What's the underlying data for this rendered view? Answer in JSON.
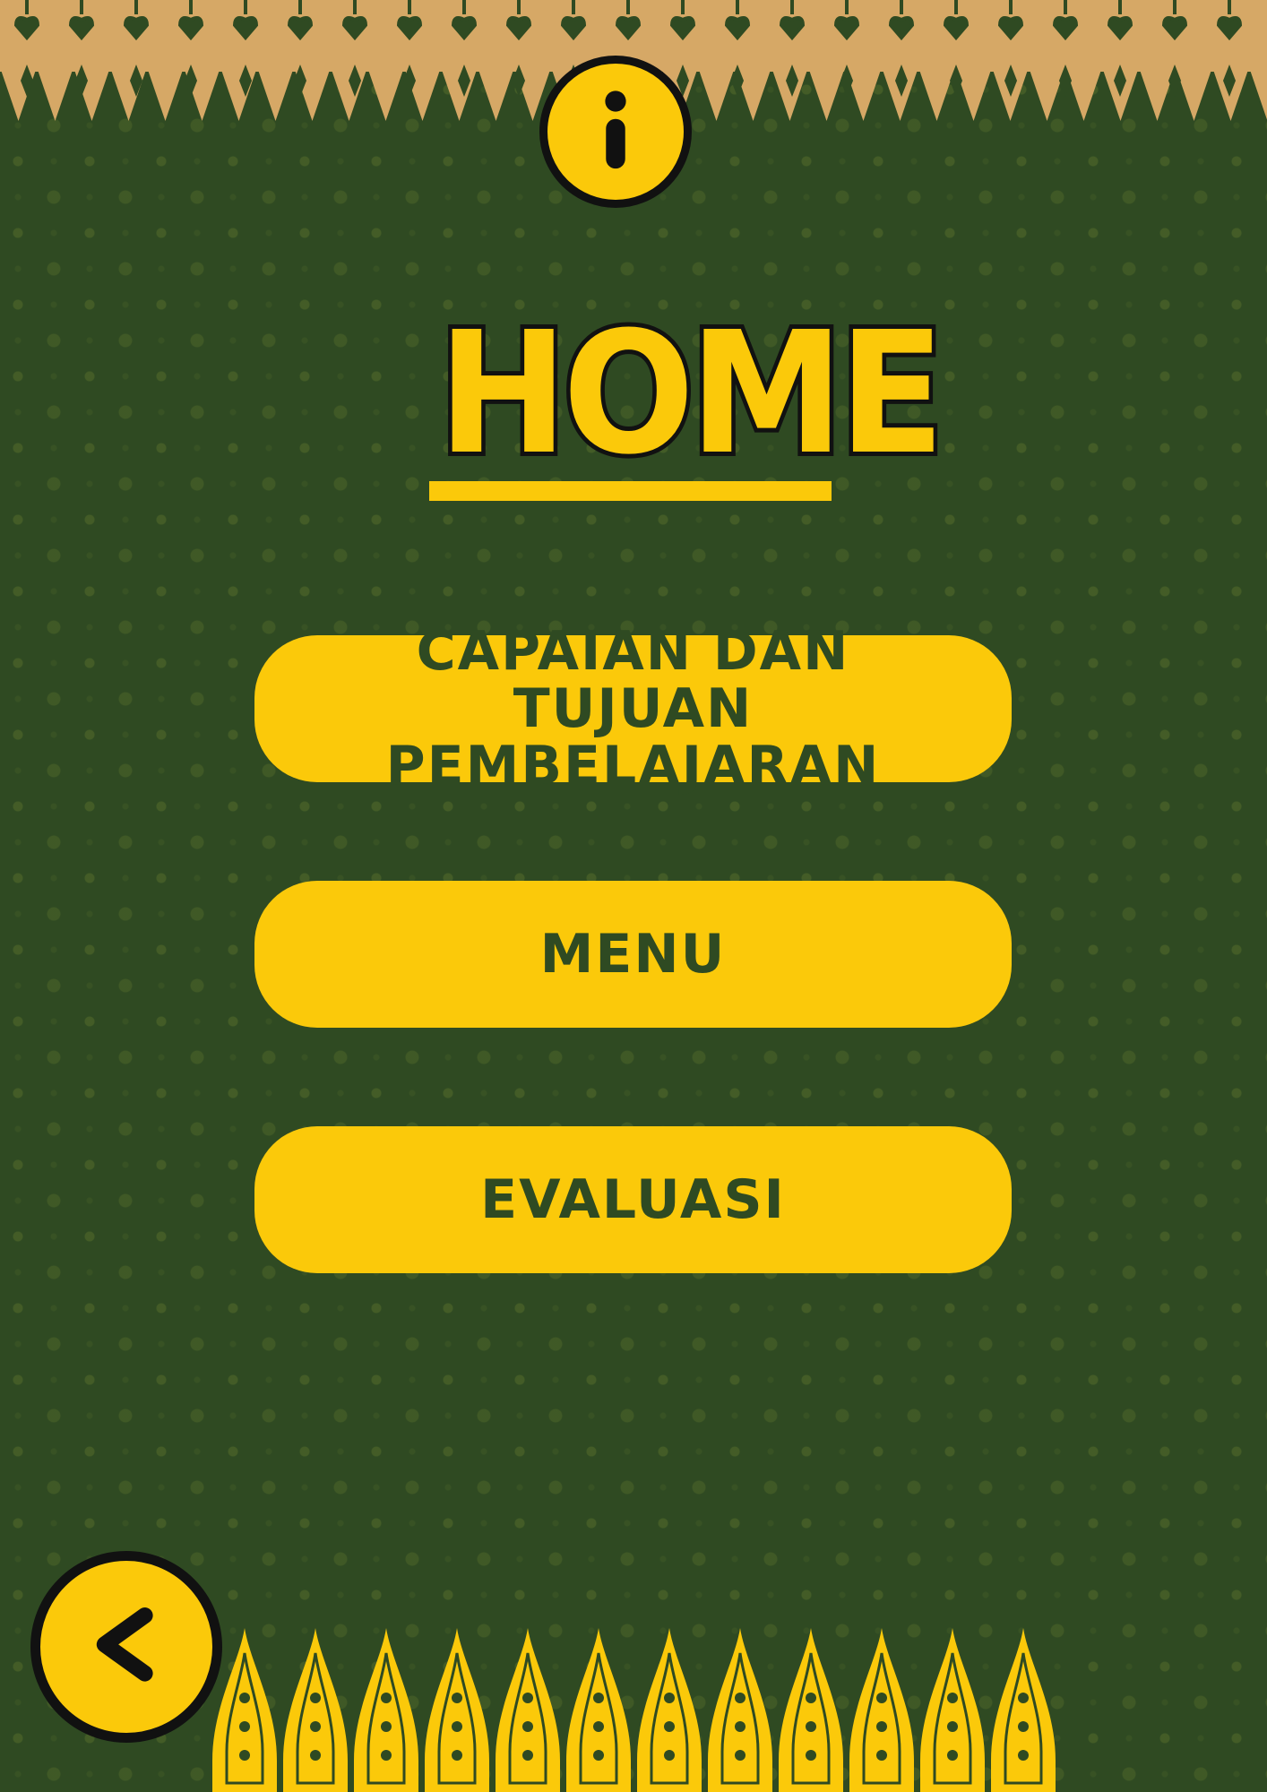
{
  "page": {
    "title": "HOME"
  },
  "header": {
    "info_icon": "info-icon"
  },
  "menu": {
    "buttons": [
      {
        "label": "CAPAIAN DAN TUJUAN\nPEMBELAJARAN"
      },
      {
        "label": "MENU"
      },
      {
        "label": "EVALUASI"
      }
    ]
  },
  "footer": {
    "back_icon": "chevron-left-icon"
  },
  "colors": {
    "background": "#2f4a22",
    "accent": "#fbc90a",
    "border_tan": "#d6a866",
    "outline": "#111111"
  }
}
